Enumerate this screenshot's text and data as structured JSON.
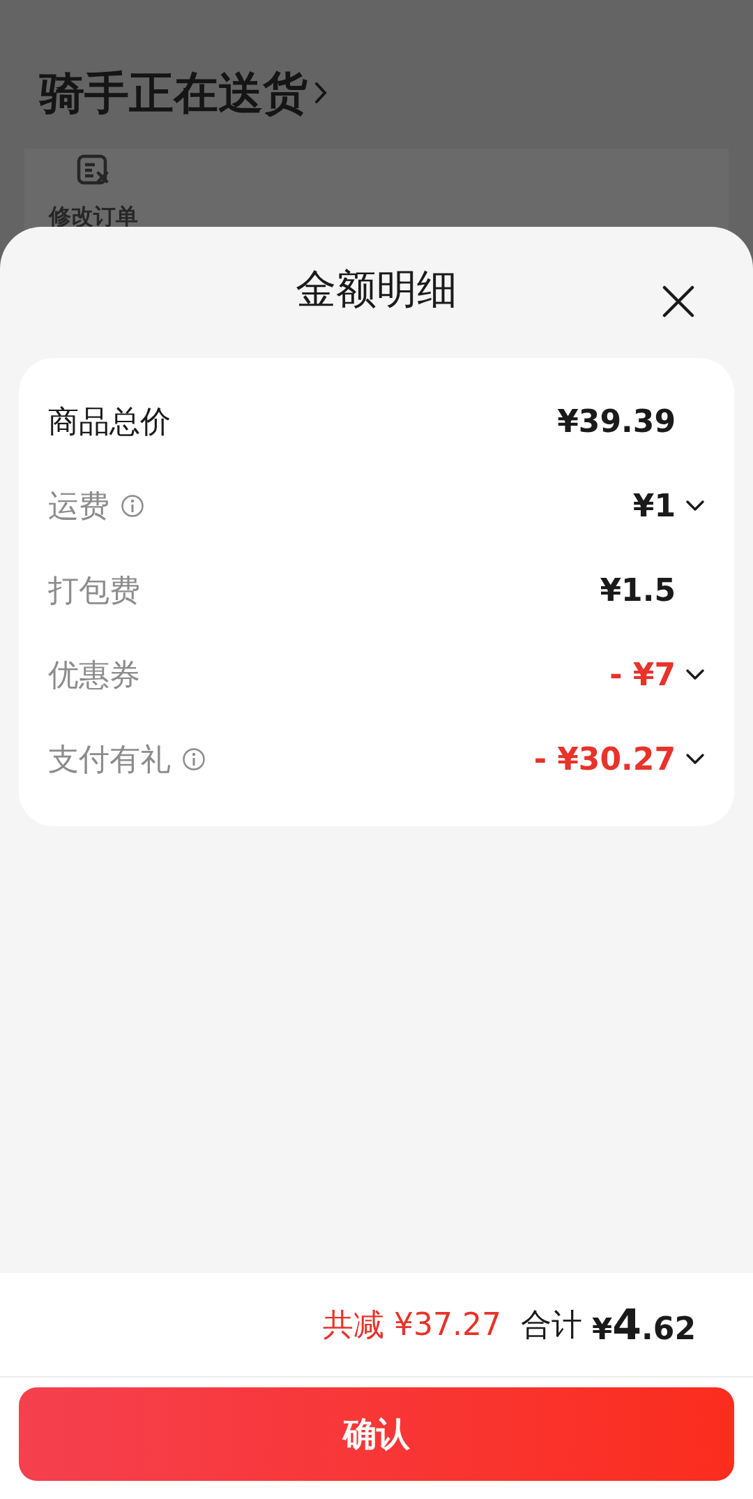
{
  "order_page": {
    "status_title": "骑手正在送货",
    "actions": [
      {
        "label": "修改订单"
      }
    ]
  },
  "sheet": {
    "title": "金额明细",
    "rows": [
      {
        "label": "商品总价",
        "primary": true,
        "info": false,
        "value": "¥39.39",
        "discount": false,
        "expandable": false
      },
      {
        "label": "运费",
        "primary": false,
        "info": true,
        "value": "¥1",
        "discount": false,
        "expandable": true
      },
      {
        "label": "打包费",
        "primary": false,
        "info": false,
        "value": "¥1.5",
        "discount": false,
        "expandable": false
      },
      {
        "label": "优惠券",
        "primary": false,
        "info": false,
        "value": "- ¥7",
        "discount": true,
        "expandable": true
      },
      {
        "label": "支付有礼",
        "primary": false,
        "info": true,
        "value": "- ¥30.27",
        "discount": true,
        "expandable": true
      }
    ]
  },
  "footer": {
    "savings": "共减 ¥37.27",
    "total_label": "合计",
    "total": {
      "currency": "¥",
      "integer": "4",
      "fraction": ".62"
    },
    "confirm_button": "确认"
  }
}
